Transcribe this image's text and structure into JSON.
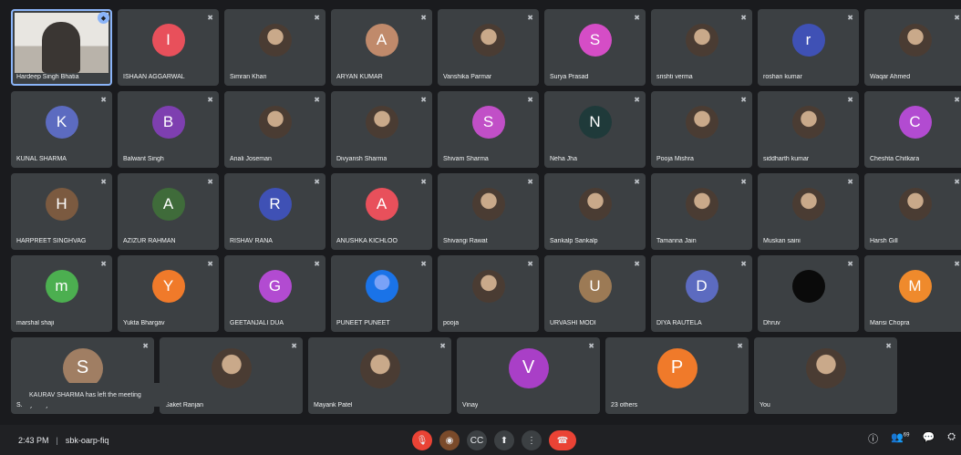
{
  "participants_rows": [
    [
      {
        "name": "Hardeep Singh Bhatia",
        "type": "self-video",
        "active": true
      },
      {
        "name": "ISHAAN AGGARWAL",
        "initial": "I",
        "color": "#e8505b"
      },
      {
        "name": "Simran Khan",
        "type": "photo"
      },
      {
        "name": "ARYAN KUMAR",
        "initial": "A",
        "color": "#c08a6b"
      },
      {
        "name": "Vanshika Parmar",
        "type": "photo"
      },
      {
        "name": "Surya Prasad",
        "initial": "S",
        "color": "#d54dc6"
      },
      {
        "name": "srishti verma",
        "type": "photo"
      },
      {
        "name": "roshan kumar",
        "initial": "r",
        "color": "#3f51b5"
      },
      {
        "name": "Waqar Ahmed",
        "type": "photo"
      }
    ],
    [
      {
        "name": "KUNAL SHARMA",
        "initial": "K",
        "color": "#5c6bc0"
      },
      {
        "name": "Balwant Singh",
        "initial": "B",
        "color": "#7e3fb0"
      },
      {
        "name": "Anali Joseman",
        "type": "photo"
      },
      {
        "name": "Divyansh Sharma",
        "type": "photo"
      },
      {
        "name": "Shivam Sharma",
        "initial": "S",
        "color": "#c14fc7"
      },
      {
        "name": "Neha Jha",
        "initial": "N",
        "color": "#1f3a3a"
      },
      {
        "name": "Pooja Mishra",
        "type": "photo"
      },
      {
        "name": "siddharth kumar",
        "type": "photo"
      },
      {
        "name": "Cheshta Chitkara",
        "initial": "C",
        "color": "#b24bd1"
      }
    ],
    [
      {
        "name": "HARPREET SINGHVAG",
        "initial": "H",
        "color": "#7b5a40"
      },
      {
        "name": "AZIZUR RAHMAN",
        "initial": "A",
        "color": "#3f6b3a"
      },
      {
        "name": "RISHAV RANA",
        "initial": "R",
        "color": "#3f51b5"
      },
      {
        "name": "ANUSHKA KICHLOO",
        "initial": "A",
        "color": "#e8505b"
      },
      {
        "name": "Shivangi Rawat",
        "type": "photo"
      },
      {
        "name": "Sankalp Sankalp",
        "type": "photo"
      },
      {
        "name": "Tamanna Jain",
        "type": "photo"
      },
      {
        "name": "Muskan saini",
        "type": "photo"
      },
      {
        "name": "Harsh Gill",
        "type": "photo"
      }
    ],
    [
      {
        "name": "marshal shaji",
        "initial": "m",
        "color": "#4caf50"
      },
      {
        "name": "Yukta Bhargav",
        "initial": "Y",
        "color": "#f07a2a"
      },
      {
        "name": "GEETANJALI DUA",
        "initial": "G",
        "color": "#b24bd1"
      },
      {
        "name": "PUNEET PUNEET",
        "type": "blank"
      },
      {
        "name": "pooja",
        "type": "photo"
      },
      {
        "name": "URVASHI MODI",
        "initial": "U",
        "color": "#9c7a55"
      },
      {
        "name": "DIYA RAUTELA",
        "initial": "D",
        "color": "#5c6bc0"
      },
      {
        "name": "Dhruv",
        "type": "dark"
      },
      {
        "name": "Mansi Chopra",
        "initial": "M",
        "color": "#ef8a2c"
      }
    ]
  ],
  "bottom_row": [
    {
      "name": "Shreya Sajwan",
      "initial": "S",
      "color": "#a07e63"
    },
    {
      "name": "Saket Ranjan",
      "type": "photo"
    },
    {
      "name": "Mayank Patel",
      "type": "photo"
    },
    {
      "name": "Vinay",
      "initial": "V",
      "color": "#a93fc7"
    },
    {
      "name": "23 others",
      "initial": "P",
      "color": "#f07a2a"
    },
    {
      "name": "You",
      "type": "photo"
    }
  ],
  "toast": "KAURAV SHARMA has left the meeting",
  "footer": {
    "time": "2:43 PM",
    "separator": "|",
    "meeting_code": "sbk-oarp-fiq"
  },
  "icons": {
    "mic": "mic-off-icon",
    "pin": "pin-icon",
    "hangup": "hangup-icon",
    "captions": "captions-icon",
    "present": "present-icon",
    "more": "more-icon",
    "info": "info-icon",
    "people": "people-icon",
    "chat": "chat-icon",
    "activities": "activities-icon"
  },
  "controls": {
    "mic": "🎙",
    "cam": "◉",
    "cc": "CC",
    "present": "⬆",
    "more": "⋮",
    "hangup": "☎"
  },
  "right_icons": {
    "info": "ⓘ",
    "people": "👥",
    "chat": "💬",
    "activities": "⛭"
  },
  "people_count": "69"
}
